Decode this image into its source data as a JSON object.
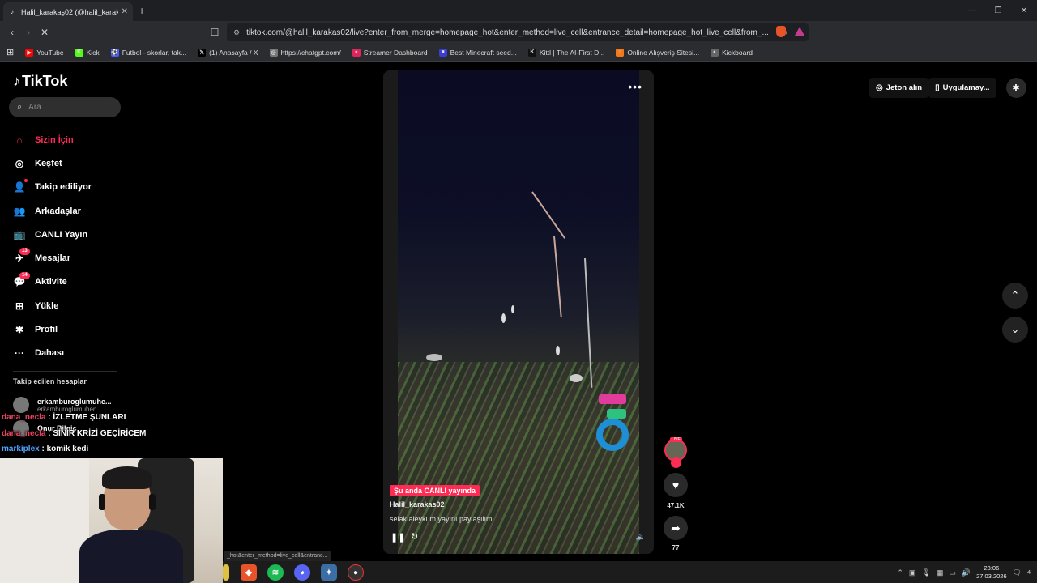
{
  "browser": {
    "tab_title": "Halil_karakaş02 (@halil_karaka...",
    "tab_close": "✕",
    "new_tab": "+",
    "url": "tiktok.com/@halil_karakas02/live?enter_from_merge=homepage_hot&enter_method=live_cell&entrance_detail=homepage_hot_live_cell&from_...",
    "status_url": "_hot&enter_method=live_cell&entranc..."
  },
  "bookmarks": [
    {
      "label": "YouTube",
      "icon": "youtube-icon",
      "color": "#ff0000",
      "glyph": "▶"
    },
    {
      "label": "Kick",
      "icon": "kick-icon",
      "color": "#53fc18",
      "glyph": "K"
    },
    {
      "label": "Futbol - skorlar, tak...",
      "icon": "futbol-icon",
      "color": "#4a5cff",
      "glyph": "⚽"
    },
    {
      "label": "(1) Anasayfa / X",
      "icon": "x-icon",
      "color": "#000000",
      "glyph": "𝕏"
    },
    {
      "label": "https://chatgpt.com/",
      "icon": "chatgpt-icon",
      "color": "#777777",
      "glyph": "◎"
    },
    {
      "label": "Streamer Dashboard",
      "icon": "streamer-icon",
      "color": "#e0245e",
      "glyph": "♦"
    },
    {
      "label": "Best Minecraft seed...",
      "icon": "minecraft-icon",
      "color": "#3b3bd6",
      "glyph": "■"
    },
    {
      "label": "Kittl | The AI-First D...",
      "icon": "kittl-icon",
      "color": "#111111",
      "glyph": "K"
    },
    {
      "label": "Online Alışveriş Sitesi...",
      "icon": "shop-icon",
      "color": "#f27a1a",
      "glyph": "○"
    },
    {
      "label": "Kickboard",
      "icon": "kickboard-icon",
      "color": "#666666",
      "glyph": "◐"
    }
  ],
  "tiktok": {
    "logo": "TikTok",
    "search_placeholder": "Ara",
    "menu": [
      {
        "label": "Sizin İçin",
        "icon": "home-icon",
        "glyph": "⌂",
        "active": true,
        "badge": ""
      },
      {
        "label": "Keşfet",
        "icon": "compass-icon",
        "glyph": "◎",
        "active": false,
        "badge": ""
      },
      {
        "label": "Takip ediliyor",
        "icon": "following-icon",
        "glyph": "👤",
        "active": false,
        "badge": "",
        "dot": true
      },
      {
        "label": "Arkadaşlar",
        "icon": "friends-icon",
        "glyph": "👥",
        "active": false,
        "badge": ""
      },
      {
        "label": "CANLI Yayın",
        "icon": "live-icon",
        "glyph": "📺",
        "active": false,
        "badge": ""
      },
      {
        "label": "Mesajlar",
        "icon": "messages-icon",
        "glyph": "✈",
        "active": false,
        "badge": "13"
      },
      {
        "label": "Aktivite",
        "icon": "activity-icon",
        "glyph": "💬",
        "active": false,
        "badge": "14"
      },
      {
        "label": "Yükle",
        "icon": "upload-icon",
        "glyph": "⊞",
        "active": false,
        "badge": ""
      },
      {
        "label": "Profil",
        "icon": "profile-icon",
        "glyph": "✱",
        "active": false,
        "badge": ""
      },
      {
        "label": "Dahası",
        "icon": "more-icon",
        "glyph": "···",
        "active": false,
        "badge": ""
      }
    ],
    "followed_heading": "Takip edilen hesaplar",
    "followed": [
      {
        "name": "erkamburoglumuhe...",
        "handle": "erkamburoglumuhen"
      },
      {
        "name": "Onur Bilgiç",
        "handle": ""
      }
    ],
    "top_right": {
      "coins": "Jeton alın",
      "app": "Uygulamay..."
    },
    "video": {
      "live_tag": "Şu anda CANLI yayında",
      "username": "Halil_karakas02",
      "description": "selak aleykum yayını paylaşılım",
      "likes": "47.1K",
      "shares": "77",
      "live_badge": "LIVE"
    }
  },
  "stream_chat": [
    {
      "user": "dana_necla",
      "message": " : İZLETME ŞUNLARI"
    },
    {
      "user": "dana_necla",
      "message": " : SİNİR KRİZİ GEÇİRİCEM"
    },
    {
      "user": "markiplex",
      "message": " : komik kedi"
    }
  ],
  "taskbar": {
    "time": "23:06",
    "date": "27.03.2026",
    "notif": "4"
  }
}
